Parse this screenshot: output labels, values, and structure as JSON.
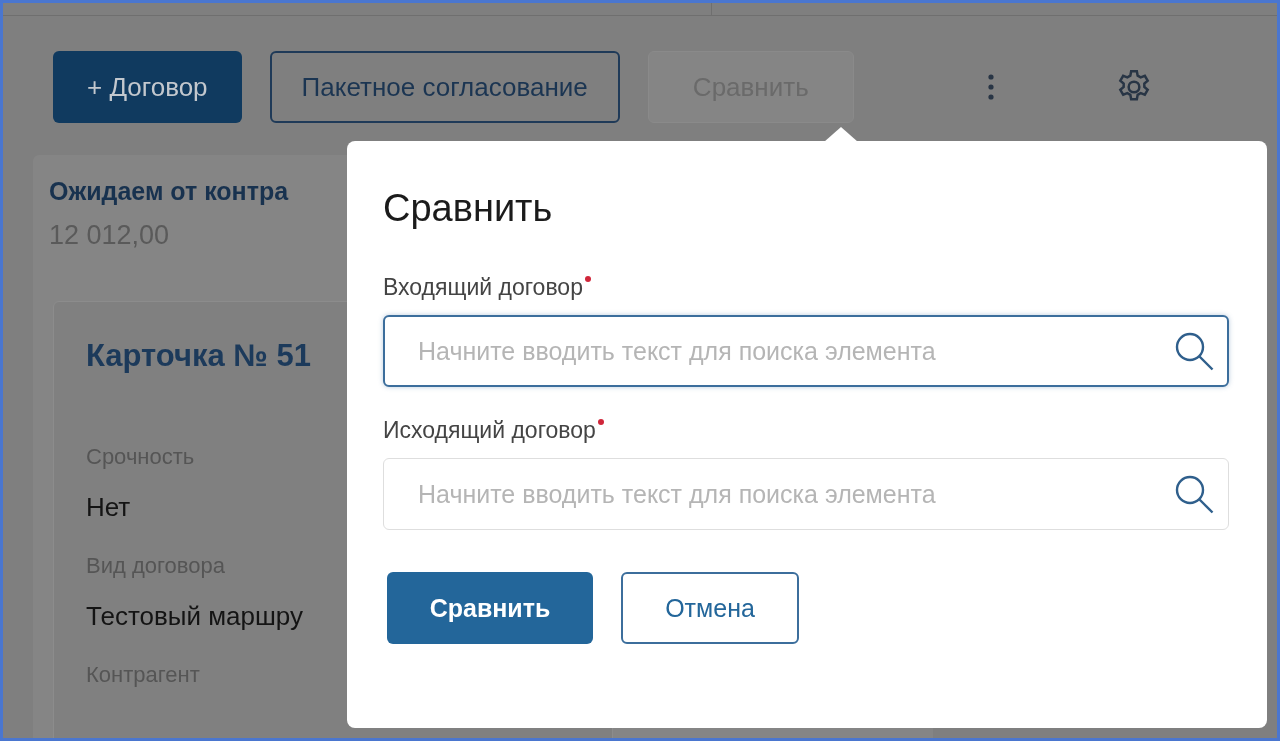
{
  "toolbar": {
    "buttons": [
      {
        "label": "+ Договор",
        "kind": "primary",
        "disabled": false
      },
      {
        "label": "Пакетное согласование",
        "kind": "outline",
        "disabled": false
      },
      {
        "label": "Сравнить",
        "kind": "plain",
        "disabled": true
      }
    ]
  },
  "summary": {
    "label": "Ожидаем от контра",
    "value": "12 012,00"
  },
  "card": {
    "title": "Карточка № 51",
    "fields": [
      {
        "label": "Срочность",
        "value": "Нет"
      },
      {
        "label": "Вид договора",
        "value": "Тестовый маршру"
      },
      {
        "label": "Контрагент"
      }
    ]
  },
  "dialog": {
    "title": "Сравнить",
    "fields": [
      {
        "label": "Входящий договор",
        "required": true,
        "focused": true,
        "placeholder": "Начните вводить текст для поиска элемента"
      },
      {
        "label": "Исходящий договор",
        "required": true,
        "focused": false,
        "placeholder": "Начните вводить текст для поиска элемента"
      }
    ],
    "buttons": [
      {
        "label": "Сравнить",
        "kind": "primary"
      },
      {
        "label": "Отмена",
        "kind": "outline"
      }
    ]
  }
}
